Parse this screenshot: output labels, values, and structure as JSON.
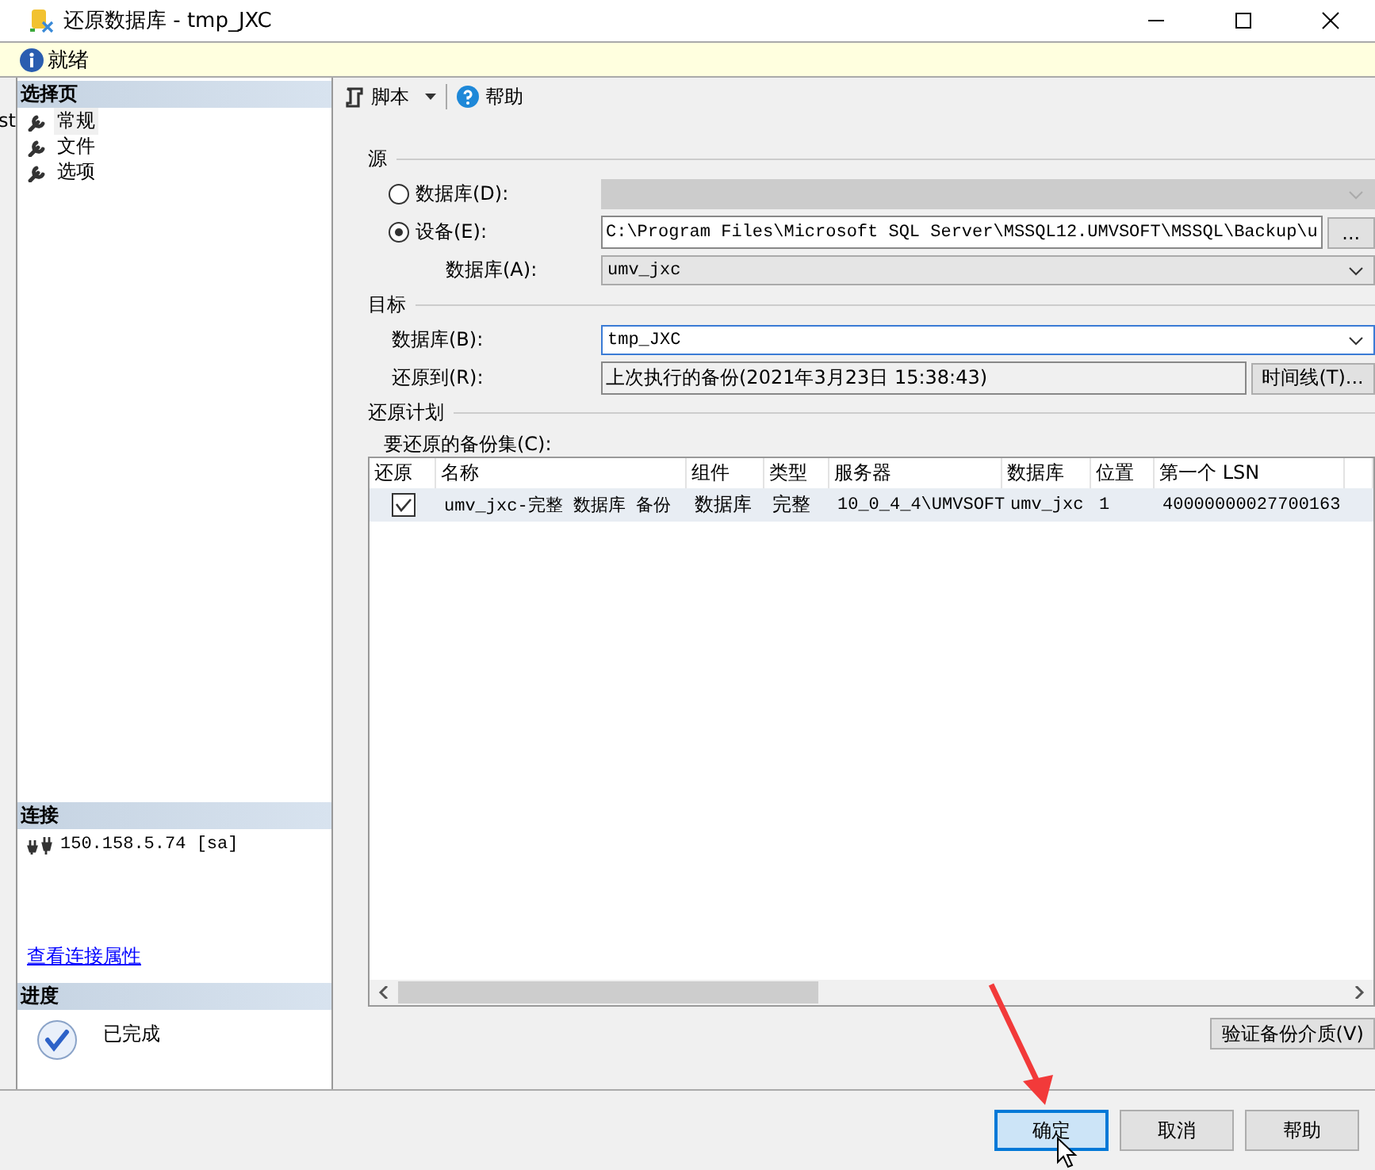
{
  "window": {
    "title": "还原数据库 - tmp_JXC"
  },
  "background_text": "st",
  "status": {
    "text": "就绪"
  },
  "sidebar": {
    "header": "选择页",
    "items": [
      {
        "label": "常规",
        "selected": true
      },
      {
        "label": "文件",
        "selected": false
      },
      {
        "label": "选项",
        "selected": false
      }
    ]
  },
  "connection": {
    "header": "连接",
    "server": "150.158.5.74 [sa]",
    "link": "查看连接属性"
  },
  "progress": {
    "header": "进度",
    "status": "已完成"
  },
  "toolbar": {
    "items": [
      {
        "kind": "script",
        "label": "脚本"
      },
      {
        "kind": "help",
        "label": "帮助"
      }
    ]
  },
  "source": {
    "title": "源",
    "database_option": {
      "label": "数据库(D):",
      "selected": false,
      "disabled": true
    },
    "device_option": {
      "label": "设备(E):",
      "selected": true,
      "value": "C:\\Program Files\\Microsoft SQL Server\\MSSQL12.UMVSOFT\\MSSQL\\Backup\\u",
      "browse": "..."
    },
    "database": {
      "label": "数据库(A):",
      "value": "umv_jxc"
    }
  },
  "destination": {
    "title": "目标",
    "database": {
      "label": "数据库(B):",
      "value": "tmp_JXC"
    },
    "restore_to": {
      "label": "还原到(R):",
      "value": "上次执行的备份(2021年3月23日 15:38:43)"
    },
    "timeline_button": "时间线(T)..."
  },
  "plan": {
    "title": "还原计划",
    "table_label": "要还原的备份集(C):",
    "columns": [
      "还原",
      "名称",
      "组件",
      "类型",
      "服务器",
      "数据库",
      "位置",
      "第一个 LSN"
    ],
    "rows": [
      {
        "checked": true,
        "cells": [
          "",
          "umv_jxc-完整 数据库 备份",
          "数据库",
          "完整",
          "10_0_4_4\\UMVSOFT",
          "umv_jxc",
          "1",
          "40000000027700163"
        ]
      }
    ]
  },
  "verify_button": "验证备份介质(V)",
  "buttons": [
    {
      "label": "确定",
      "default": true
    },
    {
      "label": "取消",
      "default": false
    },
    {
      "label": "帮助",
      "default": false
    }
  ]
}
